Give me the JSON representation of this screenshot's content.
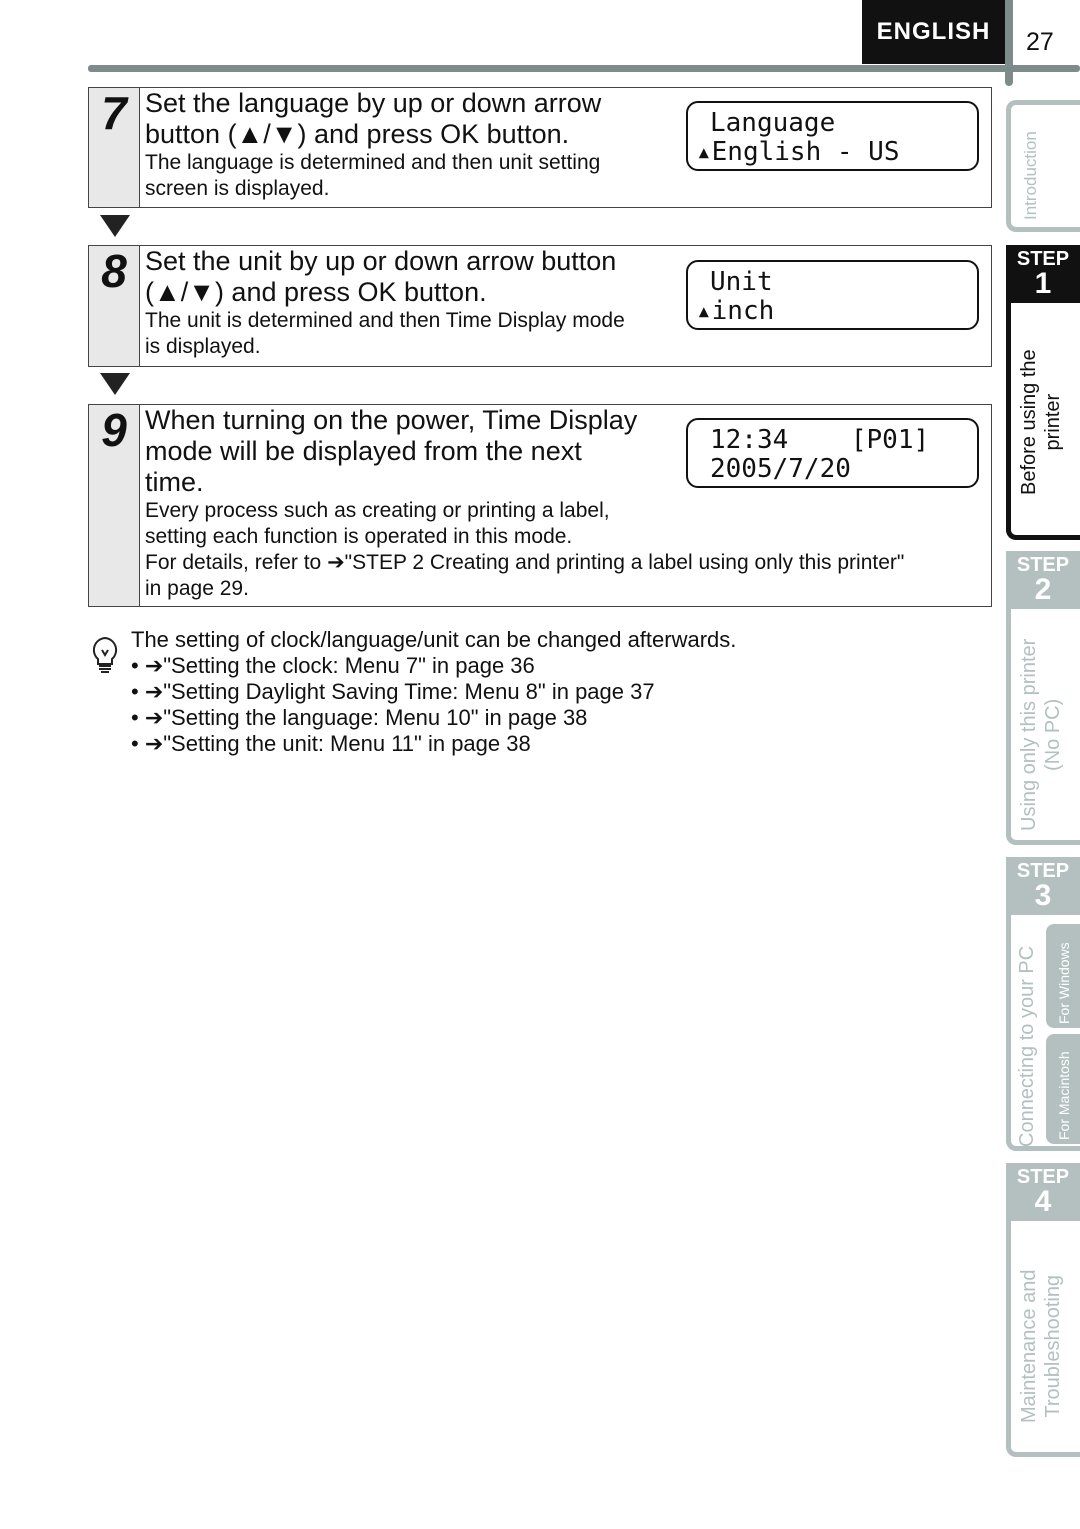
{
  "header": {
    "language": "ENGLISH",
    "page_number": "27"
  },
  "steps": [
    {
      "number": "7",
      "title_lines": [
        "Set the language by up or down arrow",
        "button (▲/▼) and press OK button."
      ],
      "desc_lines": [
        "The language is determined and then unit setting",
        "screen is displayed."
      ],
      "lcd_lines": [
        "Language",
        "▴English - US"
      ]
    },
    {
      "number": "8",
      "title_lines": [
        "Set the unit by up or down arrow button",
        "(▲/▼) and press OK button."
      ],
      "desc_lines": [
        "The unit is determined and then Time Display mode",
        "is displayed."
      ],
      "lcd_lines": [
        "Unit",
        "▴inch"
      ]
    },
    {
      "number": "9",
      "title_lines": [
        "When turning on the power, Time Display",
        "mode will be displayed from the next",
        "time."
      ],
      "desc_lines": [
        "Every process such as creating or printing a label,",
        "setting each function is operated in this mode.",
        "For details, refer to ➔\"STEP 2 Creating and printing a label using only this printer\"",
        "in page 29."
      ],
      "lcd_lines": [
        "12:34    [P01]",
        "2005/7/20"
      ]
    }
  ],
  "note": {
    "icon": "lightbulb-icon",
    "text": "The setting of clock/language/unit can be changed afterwards.",
    "items": [
      "• ➔\"Setting the clock: Menu 7\" in page 36",
      "• ➔\"Setting Daylight Saving Time: Menu 8\" in page 37",
      "• ➔\"Setting the language: Menu 10\" in page 38",
      "• ➔\"Setting the unit: Menu 11\" in page 38"
    ]
  },
  "sidebar": {
    "intro": "Introduction",
    "step_label": "STEP",
    "step1": {
      "num": "1",
      "lines": [
        "Before using the",
        "printer"
      ]
    },
    "step2": {
      "num": "2",
      "lines": [
        "Using only this printer",
        "(No PC)"
      ]
    },
    "step3": {
      "num": "3",
      "main": "Connecting to your PC",
      "sub": [
        "For Windows",
        "For Macintosh"
      ]
    },
    "step4": {
      "num": "4",
      "lines": [
        "Maintenance and",
        "Troubleshooting"
      ]
    },
    "colors": {
      "active": "#111111",
      "inactive": "#b3c0bf"
    }
  }
}
